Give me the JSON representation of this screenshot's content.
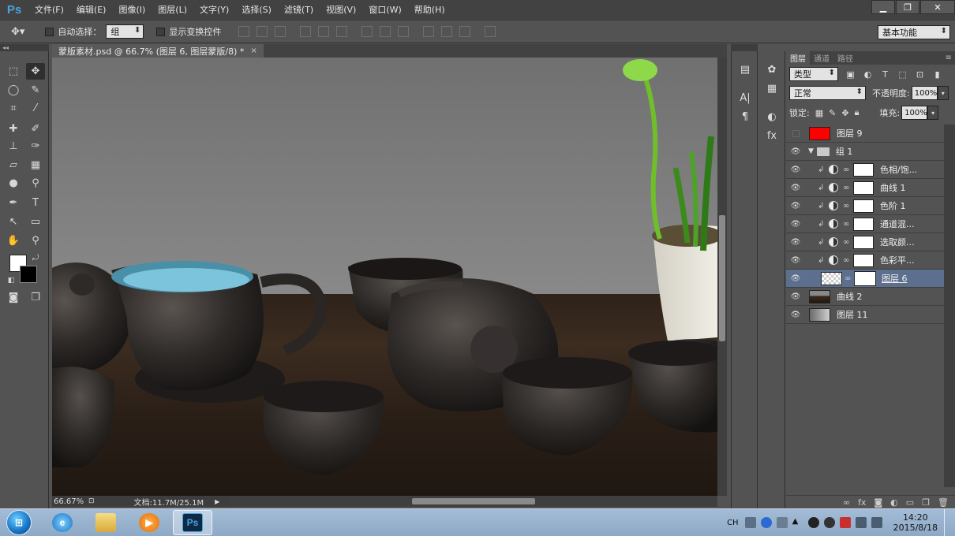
{
  "app": {
    "logo": "Ps",
    "menu": [
      "文件(F)",
      "编辑(E)",
      "图像(I)",
      "图层(L)",
      "文字(Y)",
      "选择(S)",
      "滤镜(T)",
      "视图(V)",
      "窗口(W)",
      "帮助(H)"
    ],
    "window_controls": [
      "▁",
      "❐",
      "✕"
    ]
  },
  "options_bar": {
    "auto_select_label": "自动选择：",
    "auto_select_value": "组",
    "show_transform_label": "显示变换控件",
    "workspace": "基本功能"
  },
  "document": {
    "tab_title": "蒙版素材.psd @ 66.7% (图层 6, 图层蒙版/8) *",
    "tab_close": "×",
    "zoom": "66.67%",
    "doc_info": "文档:11.7M/25.1M"
  },
  "layers_panel": {
    "tabs": [
      "图层",
      "通道",
      "路径"
    ],
    "filter_type": "类型",
    "blend_mode": "正常",
    "opacity_label": "不透明度:",
    "opacity_value": "100%",
    "lock_label": "锁定:",
    "fill_label": "填充:",
    "fill_value": "100%",
    "layers": [
      {
        "name": "图层 9",
        "kind": "fill",
        "thumb_color": "#ff0000",
        "visible": false
      },
      {
        "name": "组 1",
        "kind": "group",
        "visible": true
      },
      {
        "name": "色相/饱...",
        "kind": "adjustment",
        "visible": true
      },
      {
        "name": "曲线 1",
        "kind": "adjustment",
        "visible": true
      },
      {
        "name": "色阶 1",
        "kind": "adjustment",
        "visible": true
      },
      {
        "name": "通道混...",
        "kind": "adjustment",
        "visible": true
      },
      {
        "name": "选取颜...",
        "kind": "adjustment",
        "visible": true
      },
      {
        "name": "色彩平...",
        "kind": "adjustment",
        "visible": true
      },
      {
        "name": "图层 6",
        "kind": "masked",
        "visible": true,
        "selected": true
      },
      {
        "name": "曲线 2",
        "kind": "image",
        "visible": true
      },
      {
        "name": "图层 11",
        "kind": "gradient",
        "visible": true
      }
    ]
  },
  "taskbar": {
    "start": "⊞",
    "apps": [
      "ie",
      "explorer",
      "media",
      "photoshop"
    ],
    "ps_label": "Ps",
    "lang": "CH",
    "time": "14:20",
    "date": "2015/8/18"
  },
  "colors": {
    "accent": "#4aa3df",
    "selection": "#5c6f8e",
    "layer9_fill": "#ff0000"
  }
}
